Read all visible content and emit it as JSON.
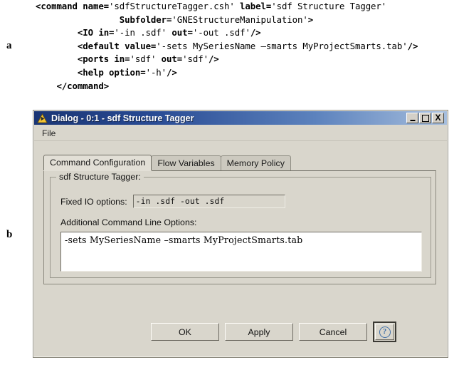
{
  "figure": {
    "panel_a_label": "a",
    "panel_b_label": "b"
  },
  "code": {
    "language": "xml",
    "lines": [
      {
        "indent": 0,
        "segments": [
          {
            "text": "<command name=",
            "bold": true
          },
          {
            "text": "'sdfStructureTagger.csh' ",
            "bold": false
          },
          {
            "text": "label=",
            "bold": true
          },
          {
            "text": "'sdf Structure Tagger'",
            "bold": false
          }
        ]
      },
      {
        "indent": 4,
        "segments": [
          {
            "text": "Subfolder=",
            "bold": true
          },
          {
            "text": "'GNEStructureManipulation'",
            "bold": false
          },
          {
            "text": ">",
            "bold": true
          }
        ]
      },
      {
        "indent": 2,
        "segments": [
          {
            "text": "<IO in=",
            "bold": true
          },
          {
            "text": "'-in .sdf' ",
            "bold": false
          },
          {
            "text": "out=",
            "bold": true
          },
          {
            "text": "'-out .sdf'",
            "bold": false
          },
          {
            "text": "/>",
            "bold": true
          }
        ]
      },
      {
        "indent": 2,
        "segments": [
          {
            "text": "<default value=",
            "bold": true
          },
          {
            "text": "'-sets MySeriesName –smarts MyProjectSmarts.tab'",
            "bold": false
          },
          {
            "text": "/>",
            "bold": true
          }
        ]
      },
      {
        "indent": 2,
        "segments": [
          {
            "text": "<ports in=",
            "bold": true
          },
          {
            "text": "'sdf' ",
            "bold": false
          },
          {
            "text": "out=",
            "bold": true
          },
          {
            "text": "'sdf'",
            "bold": false
          },
          {
            "text": "/>",
            "bold": true
          }
        ]
      },
      {
        "indent": 2,
        "segments": [
          {
            "text": "<help option=",
            "bold": true
          },
          {
            "text": "'-h'",
            "bold": false
          },
          {
            "text": "/>",
            "bold": true
          }
        ]
      },
      {
        "indent": 1,
        "segments": [
          {
            "text": "</command>",
            "bold": true
          }
        ]
      }
    ]
  },
  "dialog": {
    "title": "Dialog - 0:1 - sdf Structure Tagger",
    "icon": "warning-triangle-icon",
    "window_buttons": {
      "minimize": "_",
      "maximize": "□",
      "close": "X"
    },
    "menubar": {
      "items": [
        "File"
      ]
    },
    "tabs": [
      {
        "label": "Command Configuration",
        "active": true
      },
      {
        "label": "Flow Variables",
        "active": false
      },
      {
        "label": "Memory Policy",
        "active": false
      }
    ],
    "groupbox": {
      "legend": "sdf Structure Tagger:",
      "fixed_io": {
        "label": "Fixed IO options:",
        "value": "-in .sdf -out .sdf"
      },
      "additional_options": {
        "label": "Additional Command Line Options:",
        "value": "-sets MySeriesName –smarts MyProjectSmarts.tab"
      }
    },
    "buttons": {
      "ok": "OK",
      "apply": "Apply",
      "cancel": "Cancel",
      "help": "?"
    }
  },
  "colors": {
    "dialog_bg": "#d9d6cc",
    "titlebar_start": "#1a3574",
    "titlebar_end": "#a6bedd",
    "title_text": "#ffffff",
    "field_bg": "#ffffff",
    "help_accent": "#3f6fa8",
    "icon_yellow": "#f2c230"
  }
}
